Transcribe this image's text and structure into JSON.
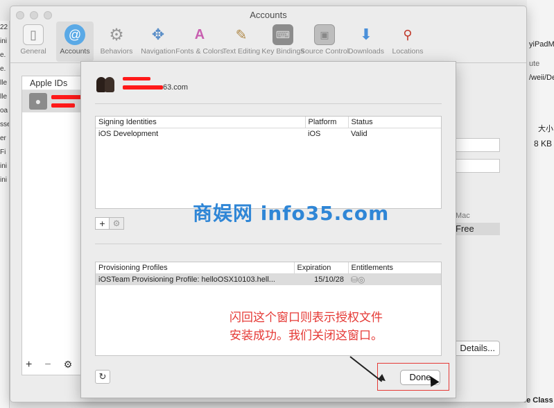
{
  "window": {
    "title": "Accounts"
  },
  "toolbar": {
    "items": [
      {
        "label": "General",
        "icon": "switch-icon"
      },
      {
        "label": "Accounts",
        "icon": "at-icon"
      },
      {
        "label": "Behaviors",
        "icon": "gear-icon"
      },
      {
        "label": "Navigation",
        "icon": "compass-icon"
      },
      {
        "label": "Fonts & Colors",
        "icon": "font-icon"
      },
      {
        "label": "Text Editing",
        "icon": "pencil-icon"
      },
      {
        "label": "Key Bindings",
        "icon": "keyboard-icon"
      },
      {
        "label": "Source Control",
        "icon": "safe-icon"
      },
      {
        "label": "Downloads",
        "icon": "download-icon"
      },
      {
        "label": "Locations",
        "icon": "joystick-icon"
      }
    ],
    "active_index": 1
  },
  "accounts_list": {
    "header": "Apple IDs"
  },
  "sheet": {
    "email_suffix": "63.com",
    "signing_table": {
      "columns": [
        "Signing Identities",
        "Platform",
        "Status"
      ],
      "rows": [
        [
          "iOS Development",
          "iOS",
          "Valid"
        ]
      ]
    },
    "profiles_table": {
      "columns": [
        "Provisioning Profiles",
        "Expiration",
        "Entitlements"
      ],
      "rows": [
        [
          "iOSTeam Provisioning Profile: helloOSX10103.hell...",
          "15/10/28",
          ""
        ]
      ]
    },
    "done_label": "Done"
  },
  "right_panel": {
    "mac_label": "Mac",
    "free_label": "Free",
    "details_label": "Details..."
  },
  "annotation": {
    "line1": "闪回这个窗口则表示授权文件",
    "line2": "安装成功。我们关闭这窗口。"
  },
  "watermark": "商娱网 info35.com",
  "background": {
    "right_labels": [
      "yiPadM",
      "ute",
      "/weii/De",
      "大小",
      "8 KB"
    ],
    "bottom_right": "UI Test Case Class"
  }
}
